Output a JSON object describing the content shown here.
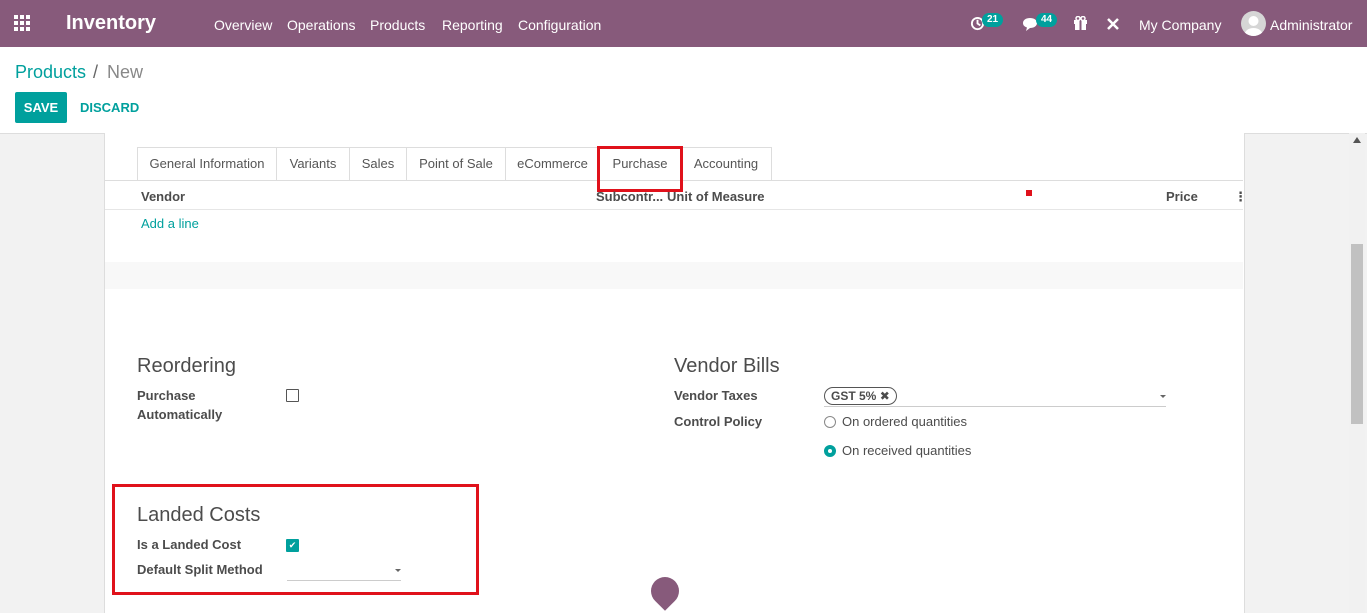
{
  "navbar": {
    "app_name": "Inventory",
    "menu": [
      "Overview",
      "Operations",
      "Products",
      "Reporting",
      "Configuration"
    ],
    "activity_count": "21",
    "messages_count": "44",
    "company": "My Company",
    "user": "Administrator"
  },
  "breadcrumb": {
    "parent": "Products",
    "separator": "/",
    "current": "New"
  },
  "actions": {
    "save": "SAVE",
    "discard": "DISCARD"
  },
  "tabs": [
    "General Information",
    "Variants",
    "Sales",
    "Point of Sale",
    "eCommerce",
    "Purchase",
    "Accounting"
  ],
  "active_tab": "Purchase",
  "vendor_table": {
    "columns": [
      "Vendor",
      "Subcontr...",
      "Unit of Measure",
      "Price"
    ],
    "add_line": "Add a line"
  },
  "reordering": {
    "title": "Reordering",
    "purchase_auto_label": "Purchase Automatically",
    "purchase_auto_checked": false
  },
  "vendor_bills": {
    "title": "Vendor Bills",
    "taxes_label": "Vendor Taxes",
    "tax_tag": "GST 5%",
    "control_label": "Control Policy",
    "options": [
      "On ordered quantities",
      "On received quantities"
    ],
    "selected_option": "On received quantities"
  },
  "landed_costs": {
    "title": "Landed Costs",
    "is_landed_label": "Is a Landed Cost",
    "is_landed_checked": true,
    "split_label": "Default Split Method",
    "split_value": ""
  },
  "colors": {
    "brand": "#875a7b",
    "accent": "#00a09d",
    "highlight": "#e0111b"
  }
}
